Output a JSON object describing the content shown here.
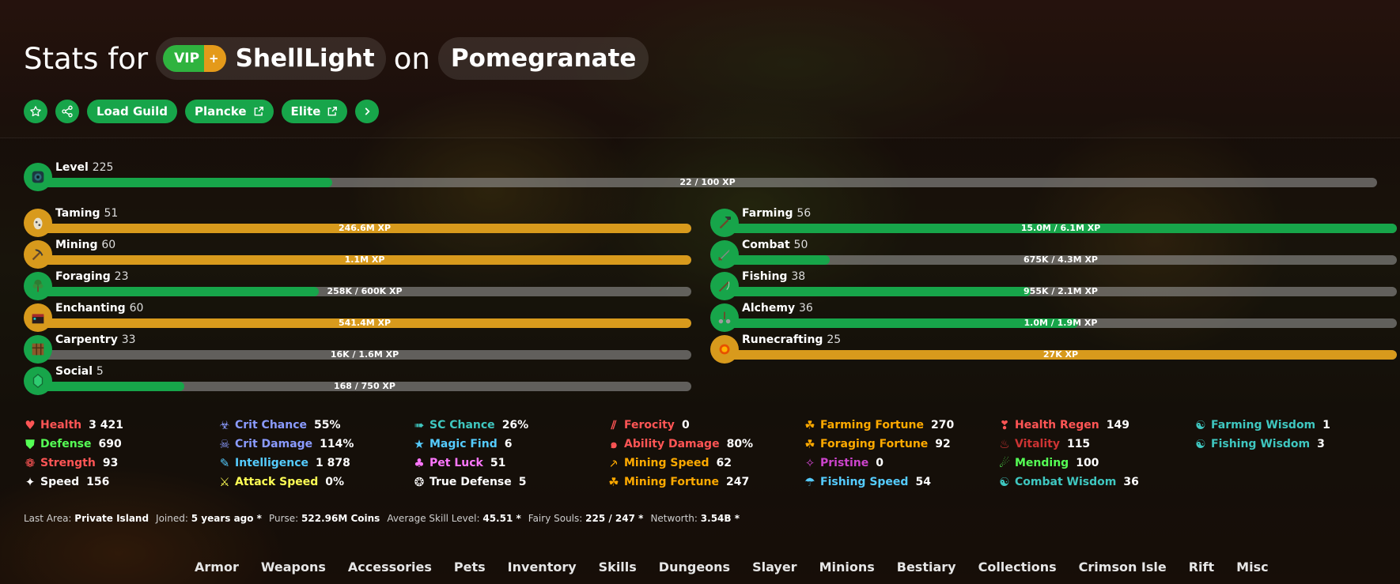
{
  "header": {
    "prefix": "Stats for",
    "rank_main": "VIP",
    "rank_plus": "+",
    "player": "ShellLight",
    "connector": "on",
    "profile": "Pomegranate"
  },
  "actions": {
    "favorite_icon": "star-icon",
    "share_icon": "share-icon",
    "load_guild": "Load Guild",
    "plancke": "Plancke",
    "elite": "Elite",
    "more_icon": "chevron-right-icon"
  },
  "level": {
    "name": "Level",
    "value": "225",
    "xp": "22 / 100 XP",
    "progress": 0.22
  },
  "skills_left": [
    {
      "name": "Taming",
      "level": "51",
      "xp": "246.6M XP",
      "progress": 1.0,
      "maxed": true,
      "icon": "spawn-egg-icon"
    },
    {
      "name": "Mining",
      "level": "60",
      "xp": "1.1M XP",
      "progress": 1.0,
      "maxed": true,
      "icon": "pickaxe-icon"
    },
    {
      "name": "Foraging",
      "level": "23",
      "xp": "258K / 600K XP",
      "progress": 0.43,
      "maxed": false,
      "icon": "sapling-icon"
    },
    {
      "name": "Enchanting",
      "level": "60",
      "xp": "541.4M XP",
      "progress": 1.0,
      "maxed": true,
      "icon": "enchanting-table-icon"
    },
    {
      "name": "Carpentry",
      "level": "33",
      "xp": "16K / 1.6M XP",
      "progress": 0.01,
      "maxed": false,
      "icon": "crafting-table-icon"
    },
    {
      "name": "Social",
      "level": "5",
      "xp": "168 / 750 XP",
      "progress": 0.224,
      "maxed": false,
      "icon": "emerald-icon"
    }
  ],
  "skills_right": [
    {
      "name": "Farming",
      "level": "56",
      "xp": "15.0M / 6.1M XP",
      "progress": 1.0,
      "maxed": false,
      "icon": "hoe-icon"
    },
    {
      "name": "Combat",
      "level": "50",
      "xp": "675K / 4.3M XP",
      "progress": 0.157,
      "maxed": false,
      "icon": "sword-icon"
    },
    {
      "name": "Fishing",
      "level": "38",
      "xp": "955K / 2.1M XP",
      "progress": 0.455,
      "maxed": false,
      "icon": "fishing-rod-icon"
    },
    {
      "name": "Alchemy",
      "level": "36",
      "xp": "1.0M / 1.9M XP",
      "progress": 0.526,
      "maxed": false,
      "icon": "brewing-stand-icon"
    },
    {
      "name": "Runecrafting",
      "level": "25",
      "xp": "27K XP",
      "progress": 1.0,
      "maxed": true,
      "icon": "magma-cream-icon"
    }
  ],
  "stats": [
    [
      {
        "name": "Health",
        "value": "3 421",
        "color": "#ff5555",
        "glyph": "♥",
        "icon": "heart-icon"
      },
      {
        "name": "Defense",
        "value": "690",
        "color": "#55ff55",
        "glyph": "⛊",
        "icon": "shield-icon"
      },
      {
        "name": "Strength",
        "value": "93",
        "color": "#ff5555",
        "glyph": "❁",
        "icon": "strength-icon"
      },
      {
        "name": "Speed",
        "value": "156",
        "color": "#ffffff",
        "glyph": "✦",
        "icon": "speed-icon"
      }
    ],
    [
      {
        "name": "Crit Chance",
        "value": "55%",
        "color": "#8a9bff",
        "glyph": "☣",
        "icon": "crit-chance-icon"
      },
      {
        "name": "Crit Damage",
        "value": "114%",
        "color": "#8a9bff",
        "glyph": "☠",
        "icon": "crit-damage-icon"
      },
      {
        "name": "Intelligence",
        "value": "1 878",
        "color": "#55ccff",
        "glyph": "✎",
        "icon": "intelligence-icon"
      },
      {
        "name": "Attack Speed",
        "value": "0%",
        "color": "#ffff55",
        "glyph": "⚔",
        "icon": "attack-speed-icon"
      }
    ],
    [
      {
        "name": "SC Chance",
        "value": "26%",
        "color": "#3fc7c0",
        "glyph": "➠",
        "icon": "sea-creature-icon"
      },
      {
        "name": "Magic Find",
        "value": "6",
        "color": "#55ccff",
        "glyph": "★",
        "icon": "magic-find-icon"
      },
      {
        "name": "Pet Luck",
        "value": "51",
        "color": "#ff77ff",
        "glyph": "♣",
        "icon": "pet-luck-icon"
      },
      {
        "name": "True Defense",
        "value": "5",
        "color": "#ffffff",
        "glyph": "❂",
        "icon": "true-defense-icon"
      }
    ],
    [
      {
        "name": "Ferocity",
        "value": "0",
        "color": "#ff5555",
        "glyph": "⫽",
        "icon": "ferocity-icon"
      },
      {
        "name": "Ability Damage",
        "value": "80%",
        "color": "#ff5555",
        "glyph": "๑",
        "icon": "ability-damage-icon"
      },
      {
        "name": "Mining Speed",
        "value": "62",
        "color": "#ffaa00",
        "glyph": "⸕",
        "icon": "mining-speed-icon"
      },
      {
        "name": "Mining Fortune",
        "value": "247",
        "color": "#ffaa00",
        "glyph": "☘",
        "icon": "mining-fortune-icon"
      }
    ],
    [
      {
        "name": "Farming Fortune",
        "value": "270",
        "color": "#ffaa00",
        "glyph": "☘",
        "icon": "farming-fortune-icon"
      },
      {
        "name": "Foraging Fortune",
        "value": "92",
        "color": "#ffaa00",
        "glyph": "☘",
        "icon": "foraging-fortune-icon"
      },
      {
        "name": "Pristine",
        "value": "0",
        "color": "#cc44cc",
        "glyph": "✧",
        "icon": "pristine-icon"
      },
      {
        "name": "Fishing Speed",
        "value": "54",
        "color": "#55ccff",
        "glyph": "☂",
        "icon": "fishing-speed-icon"
      }
    ],
    [
      {
        "name": "Health Regen",
        "value": "149",
        "color": "#ff5555",
        "glyph": "❣",
        "icon": "health-regen-icon"
      },
      {
        "name": "Vitality",
        "value": "115",
        "color": "#cc3333",
        "glyph": "♨",
        "icon": "vitality-icon"
      },
      {
        "name": "Mending",
        "value": "100",
        "color": "#55ff55",
        "glyph": "☄",
        "icon": "mending-icon"
      },
      {
        "name": "Combat Wisdom",
        "value": "36",
        "color": "#3fc7c0",
        "glyph": "☯",
        "icon": "combat-wisdom-icon"
      }
    ],
    [
      {
        "name": "Farming Wisdom",
        "value": "1",
        "color": "#3fc7c0",
        "glyph": "☯",
        "icon": "farming-wisdom-icon"
      },
      {
        "name": "Fishing Wisdom",
        "value": "3",
        "color": "#3fc7c0",
        "glyph": "☯",
        "icon": "fishing-wisdom-icon"
      }
    ]
  ],
  "info": [
    {
      "key": "Last Area:",
      "value": "Private Island"
    },
    {
      "key": "Joined:",
      "value": "5 years ago *"
    },
    {
      "key": "Purse:",
      "value": "522.96M Coins"
    },
    {
      "key": "Average Skill Level:",
      "value": "45.51 *"
    },
    {
      "key": "Fairy Souls:",
      "value": "225 / 247 *"
    },
    {
      "key": "Networth:",
      "value": "3.54B *"
    }
  ],
  "nav": [
    "Armor",
    "Weapons",
    "Accessories",
    "Pets",
    "Inventory",
    "Skills",
    "Dungeons",
    "Slayer",
    "Minions",
    "Bestiary",
    "Collections",
    "Crimson Isle",
    "Rift",
    "Misc"
  ],
  "colors": {
    "green": "#17a54a",
    "gold": "#d89a1c",
    "track": "#8a8a8a"
  }
}
